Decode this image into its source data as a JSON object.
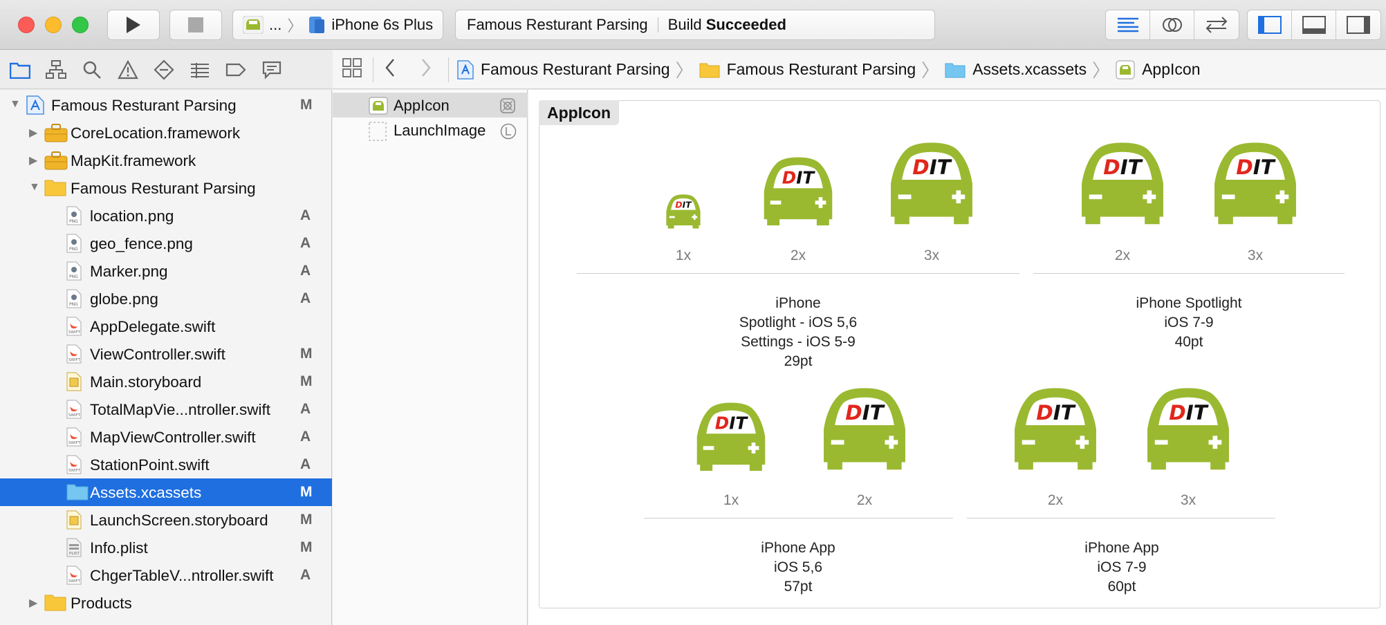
{
  "toolbar": {
    "scheme_target": "...",
    "scheme_device": "iPhone 6s Plus",
    "activity_project": "Famous Resturant Parsing",
    "activity_prefix": "Build",
    "activity_status": "Succeeded"
  },
  "jump_bar": {
    "crumbs": [
      "Famous Resturant Parsing",
      "Famous Resturant Parsing",
      "Assets.xcassets",
      "AppIcon"
    ]
  },
  "navigator": {
    "items": [
      {
        "label": "Famous Resturant Parsing",
        "status": "M",
        "icon": "project-icon",
        "expanded": true
      },
      {
        "label": "CoreLocation.framework",
        "status": "",
        "icon": "toolbox-icon",
        "expanded": false
      },
      {
        "label": "MapKit.framework",
        "status": "",
        "icon": "toolbox-icon",
        "expanded": false
      },
      {
        "label": "Famous Resturant Parsing",
        "status": "",
        "icon": "folder-icon",
        "expanded": true
      },
      {
        "label": "location.png",
        "status": "A",
        "icon": "png-file-icon"
      },
      {
        "label": "geo_fence.png",
        "status": "A",
        "icon": "png-file-icon"
      },
      {
        "label": "Marker.png",
        "status": "A",
        "icon": "png-file-icon"
      },
      {
        "label": "globe.png",
        "status": "A",
        "icon": "png-file-icon"
      },
      {
        "label": "AppDelegate.swift",
        "status": "",
        "icon": "swift-file-icon"
      },
      {
        "label": "ViewController.swift",
        "status": "M",
        "icon": "swift-file-icon"
      },
      {
        "label": "Main.storyboard",
        "status": "M",
        "icon": "storyboard-file-icon"
      },
      {
        "label": "TotalMapVie...ntroller.swift",
        "status": "A",
        "icon": "swift-file-icon"
      },
      {
        "label": "MapViewController.swift",
        "status": "A",
        "icon": "swift-file-icon"
      },
      {
        "label": "StationPoint.swift",
        "status": "A",
        "icon": "swift-file-icon"
      },
      {
        "label": "Assets.xcassets",
        "status": "M",
        "icon": "asset-folder-icon",
        "selected": true
      },
      {
        "label": "LaunchScreen.storyboard",
        "status": "M",
        "icon": "storyboard-file-icon"
      },
      {
        "label": "Info.plist",
        "status": "M",
        "icon": "plist-file-icon"
      },
      {
        "label": "ChgerTableV...ntroller.swift",
        "status": "A",
        "icon": "swift-file-icon"
      },
      {
        "label": "Products",
        "status": "",
        "icon": "folder-icon",
        "expanded": false
      }
    ]
  },
  "asset_list": {
    "items": [
      {
        "label": "AppIcon",
        "selected": true
      },
      {
        "label": "LaunchImage",
        "selected": false
      }
    ]
  },
  "editor": {
    "set_title": "AppIcon",
    "groups": [
      {
        "scales": [
          "1x",
          "2x",
          "3x"
        ],
        "caption": [
          "iPhone",
          "Spotlight - iOS 5,6",
          "Settings - iOS 5-9",
          "29pt"
        ]
      },
      {
        "scales": [
          "2x",
          "3x"
        ],
        "caption": [
          "iPhone Spotlight",
          "iOS 7-9",
          "40pt"
        ]
      },
      {
        "scales": [
          "1x",
          "2x"
        ],
        "caption": [
          "iPhone App",
          "iOS 5,6",
          "57pt"
        ]
      },
      {
        "scales": [
          "2x",
          "3x"
        ],
        "caption": [
          "iPhone App",
          "iOS 7-9",
          "60pt"
        ]
      }
    ],
    "icon_brand_text": "DIT"
  },
  "colors": {
    "accent": "#1f6fe0",
    "car_green": "#9ab931",
    "brand_red": "#e1261c"
  }
}
